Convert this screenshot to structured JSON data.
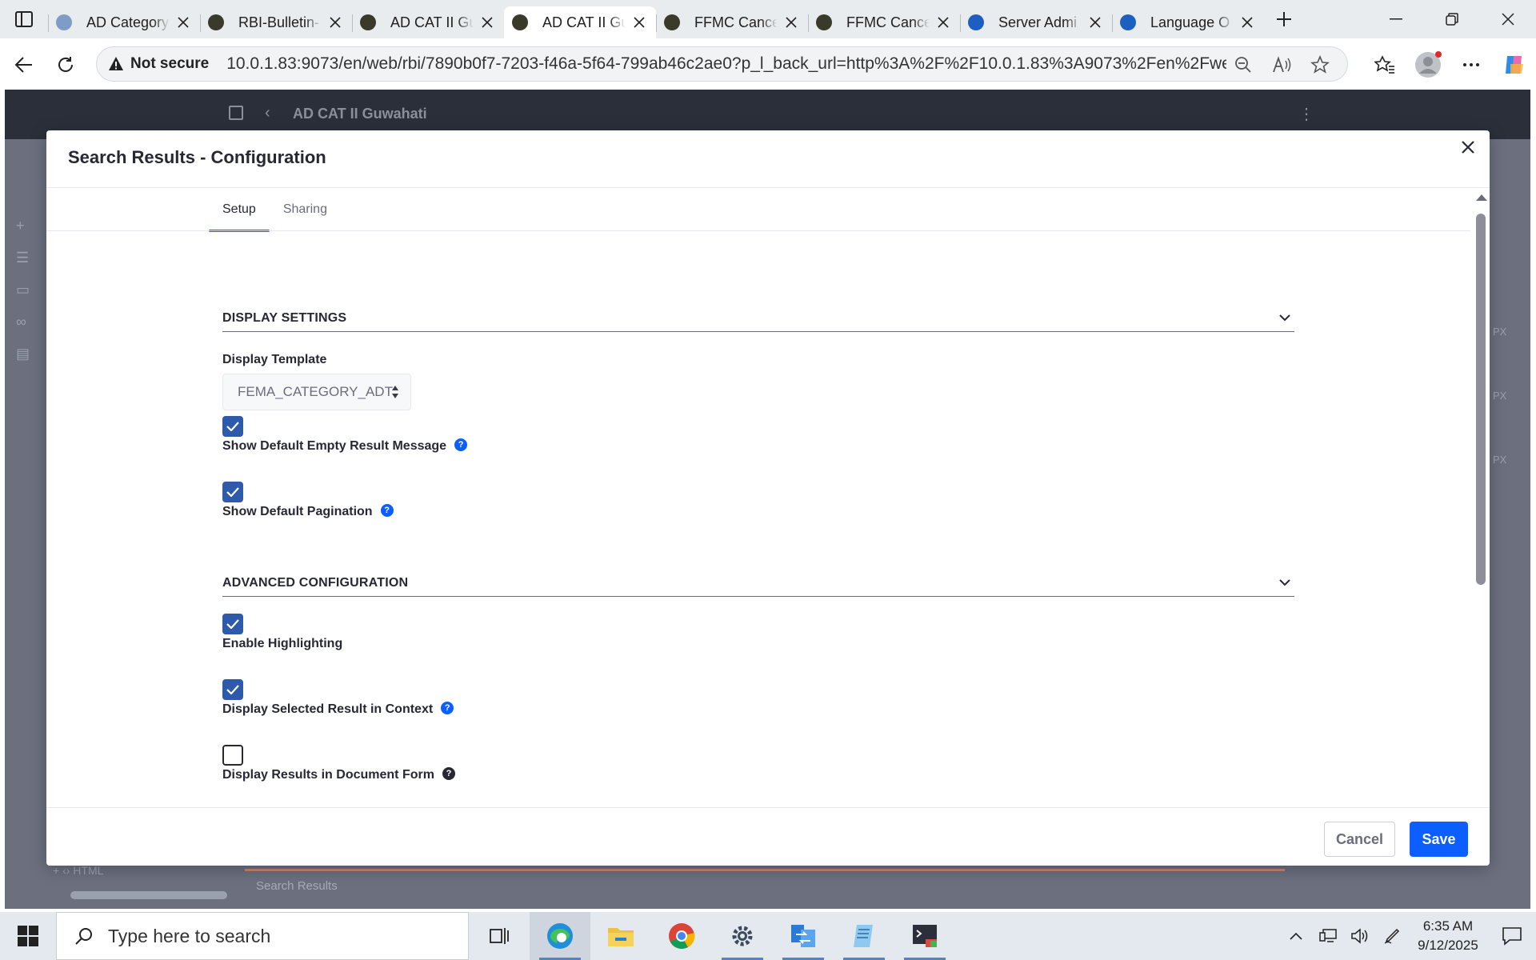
{
  "browser": {
    "tabs": [
      {
        "title": "AD Category",
        "favicon_color": "#7f9cc7",
        "active": false
      },
      {
        "title": "RBI-Bulletin-",
        "favicon_color": "#3a3a2a",
        "active": false
      },
      {
        "title": "AD CAT II Gu",
        "favicon_color": "#3a3a2a",
        "active": false
      },
      {
        "title": "AD CAT II Gu",
        "favicon_color": "#3a3a2a",
        "active": true
      },
      {
        "title": "FFMC Cance",
        "favicon_color": "#3a3a2a",
        "active": false
      },
      {
        "title": "FFMC Cance",
        "favicon_color": "#3a3a2a",
        "active": false
      },
      {
        "title": "Server Admi",
        "favicon_color": "#1d5fc1",
        "active": false
      },
      {
        "title": "Language O",
        "favicon_color": "#1d5fc1",
        "active": false
      }
    ],
    "security_label": "Not secure",
    "url": "10.0.1.83:9073/en/web/rbi/7890b0f7-7203-f46a-5f64-799ab46c2ae0?p_l_back_url=http%3A%2F%2F10.0.1.83%3A9073%2Fen%2Fweb..."
  },
  "page": {
    "title": "AD CAT II Guwahati",
    "bottom_label": "Search Results",
    "bottom_left": "+  ‹› HTML",
    "px_label": "PX"
  },
  "modal": {
    "title": "Search Results - Configuration",
    "tabs": [
      {
        "label": "Setup",
        "active": true
      },
      {
        "label": "Sharing",
        "active": false
      }
    ],
    "sections": {
      "display": "DISPLAY SETTINGS",
      "advanced": "ADVANCED CONFIGURATION"
    },
    "display_template": {
      "label": "Display Template",
      "value": "FEMA_CATEGORY_ADT"
    },
    "checkboxes": [
      {
        "label": "Show Default Empty Result Message",
        "checked": true,
        "help": true
      },
      {
        "label": "Show Default Pagination",
        "checked": true,
        "help": true
      },
      {
        "label": "Enable Highlighting",
        "checked": true,
        "help": false
      },
      {
        "label": "Display Selected Result in Context",
        "checked": true,
        "help": true
      },
      {
        "label": "Display Results in Document Form",
        "checked": false,
        "help": true
      }
    ],
    "help_glyph": "?",
    "cancel_label": "Cancel",
    "save_label": "Save"
  },
  "taskbar": {
    "search_placeholder": "Type here to search",
    "time": "6:35 AM",
    "date": "9/12/2025"
  },
  "colors": {
    "primary": "#0b5fff",
    "checkbox": "#2e5aac",
    "overlay_bg": "#6b6f7e"
  }
}
